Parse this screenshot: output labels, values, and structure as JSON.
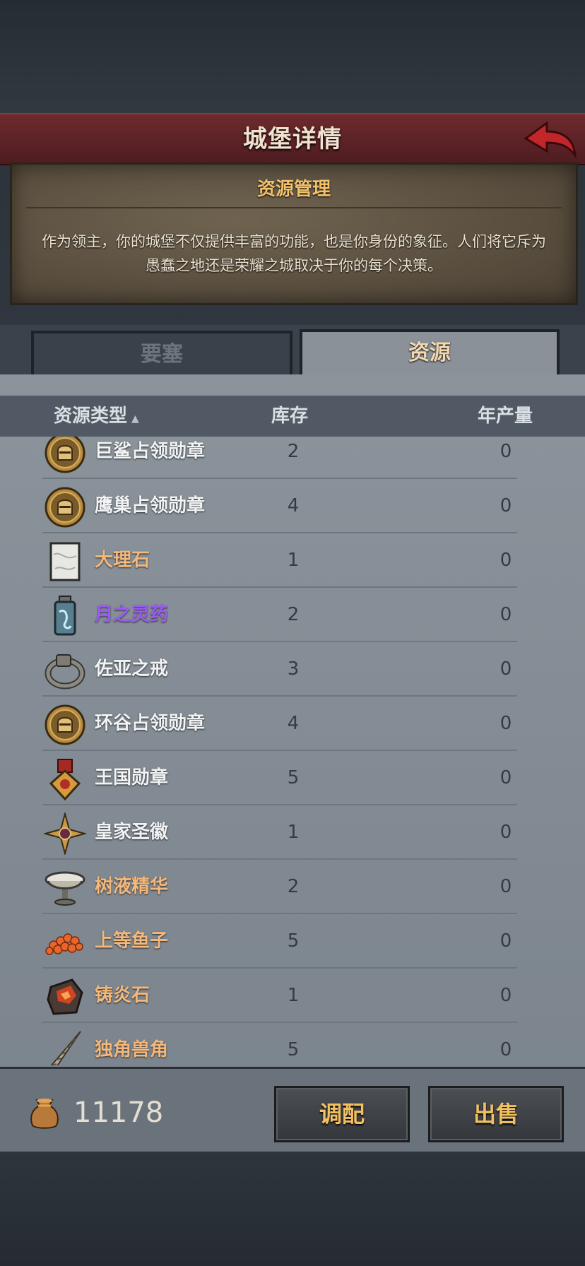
{
  "header": {
    "title": "城堡详情"
  },
  "intro": {
    "title": "资源管理",
    "text": "作为领主，你的城堡不仅提供丰富的功能，也是你身份的象征。人们将它斥为愚蠢之地还是荣耀之城取决于你的每个决策。"
  },
  "tabs": [
    {
      "label": "要塞"
    },
    {
      "label": "资源"
    }
  ],
  "columns": {
    "type": "资源类型",
    "stock": "库存",
    "production": "年产量"
  },
  "resources": [
    {
      "name": "巨鲨占领勋章",
      "stock": "2",
      "production": "0",
      "icon": "knight-medal-icon",
      "color": "#f1f3f4"
    },
    {
      "name": "鹰巢占领勋章",
      "stock": "4",
      "production": "0",
      "icon": "knight-medal-icon",
      "color": "#f1f3f4"
    },
    {
      "name": "大理石",
      "stock": "1",
      "production": "0",
      "icon": "marble-icon",
      "color": "#f3b87a"
    },
    {
      "name": "月之灵药",
      "stock": "2",
      "production": "0",
      "icon": "potion-bottle-icon",
      "color": "#9a5cf0"
    },
    {
      "name": "佐亚之戒",
      "stock": "3",
      "production": "0",
      "icon": "ring-icon",
      "color": "#f1f3f4"
    },
    {
      "name": "环谷占领勋章",
      "stock": "4",
      "production": "0",
      "icon": "knight-medal-icon",
      "color": "#f1f3f4"
    },
    {
      "name": "王国勋章",
      "stock": "5",
      "production": "0",
      "icon": "kingdom-medal-icon",
      "color": "#f1f3f4"
    },
    {
      "name": "皇家圣徽",
      "stock": "1",
      "production": "0",
      "icon": "royal-emblem-icon",
      "color": "#f1f3f4"
    },
    {
      "name": "树液精华",
      "stock": "2",
      "production": "0",
      "icon": "sap-bowl-icon",
      "color": "#f3b87a"
    },
    {
      "name": "上等鱼子",
      "stock": "5",
      "production": "0",
      "icon": "caviar-icon",
      "color": "#f3b87a"
    },
    {
      "name": "铸炎石",
      "stock": "1",
      "production": "0",
      "icon": "fire-stone-icon",
      "color": "#f3b87a"
    },
    {
      "name": "独角兽角",
      "stock": "5",
      "production": "0",
      "icon": "unicorn-horn-icon",
      "color": "#f3b87a"
    }
  ],
  "footer": {
    "gold": "11178",
    "allocate_label": "调配",
    "sell_label": "出售"
  }
}
